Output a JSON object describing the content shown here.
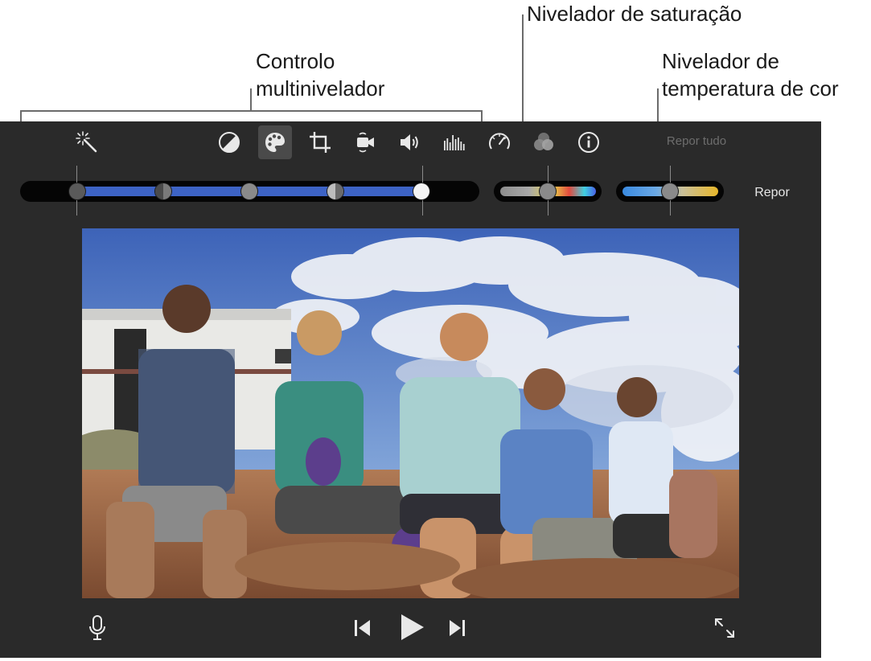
{
  "callouts": {
    "multi": {
      "line1": "Controlo",
      "line2": "multinivelador"
    },
    "saturation": "Nivelador de saturação",
    "temperature": {
      "line1": "Nivelador de",
      "line2": "temperatura de cor"
    }
  },
  "toolbar": {
    "tools": [
      {
        "name": "magic-wand-icon"
      },
      {
        "name": "contrast-icon"
      },
      {
        "name": "palette-icon",
        "active": true
      },
      {
        "name": "crop-icon"
      },
      {
        "name": "stabilize-camera-icon"
      },
      {
        "name": "volume-icon"
      },
      {
        "name": "equalizer-icon"
      },
      {
        "name": "speedometer-icon"
      },
      {
        "name": "color-filter-icon"
      },
      {
        "name": "info-icon"
      }
    ],
    "reset_all_label": "Repor tudo"
  },
  "sliders": {
    "multi": {
      "values": [
        0,
        0.2,
        0.4,
        0.6,
        0.8
      ]
    },
    "saturation": {
      "value": 0.5
    },
    "temperature": {
      "value": 0.5
    },
    "reset_label": "Repor"
  },
  "colors": {
    "panel": "#2a2a2a",
    "blue_track": "#3d63c5",
    "reset_all": "#6d6d6d"
  },
  "playback": {
    "microphone": "microphone-icon",
    "skip_back": "skip-back-icon",
    "play": "play-icon",
    "skip_forward": "skip-forward-icon",
    "fullscreen": "fullscreen-icon"
  }
}
